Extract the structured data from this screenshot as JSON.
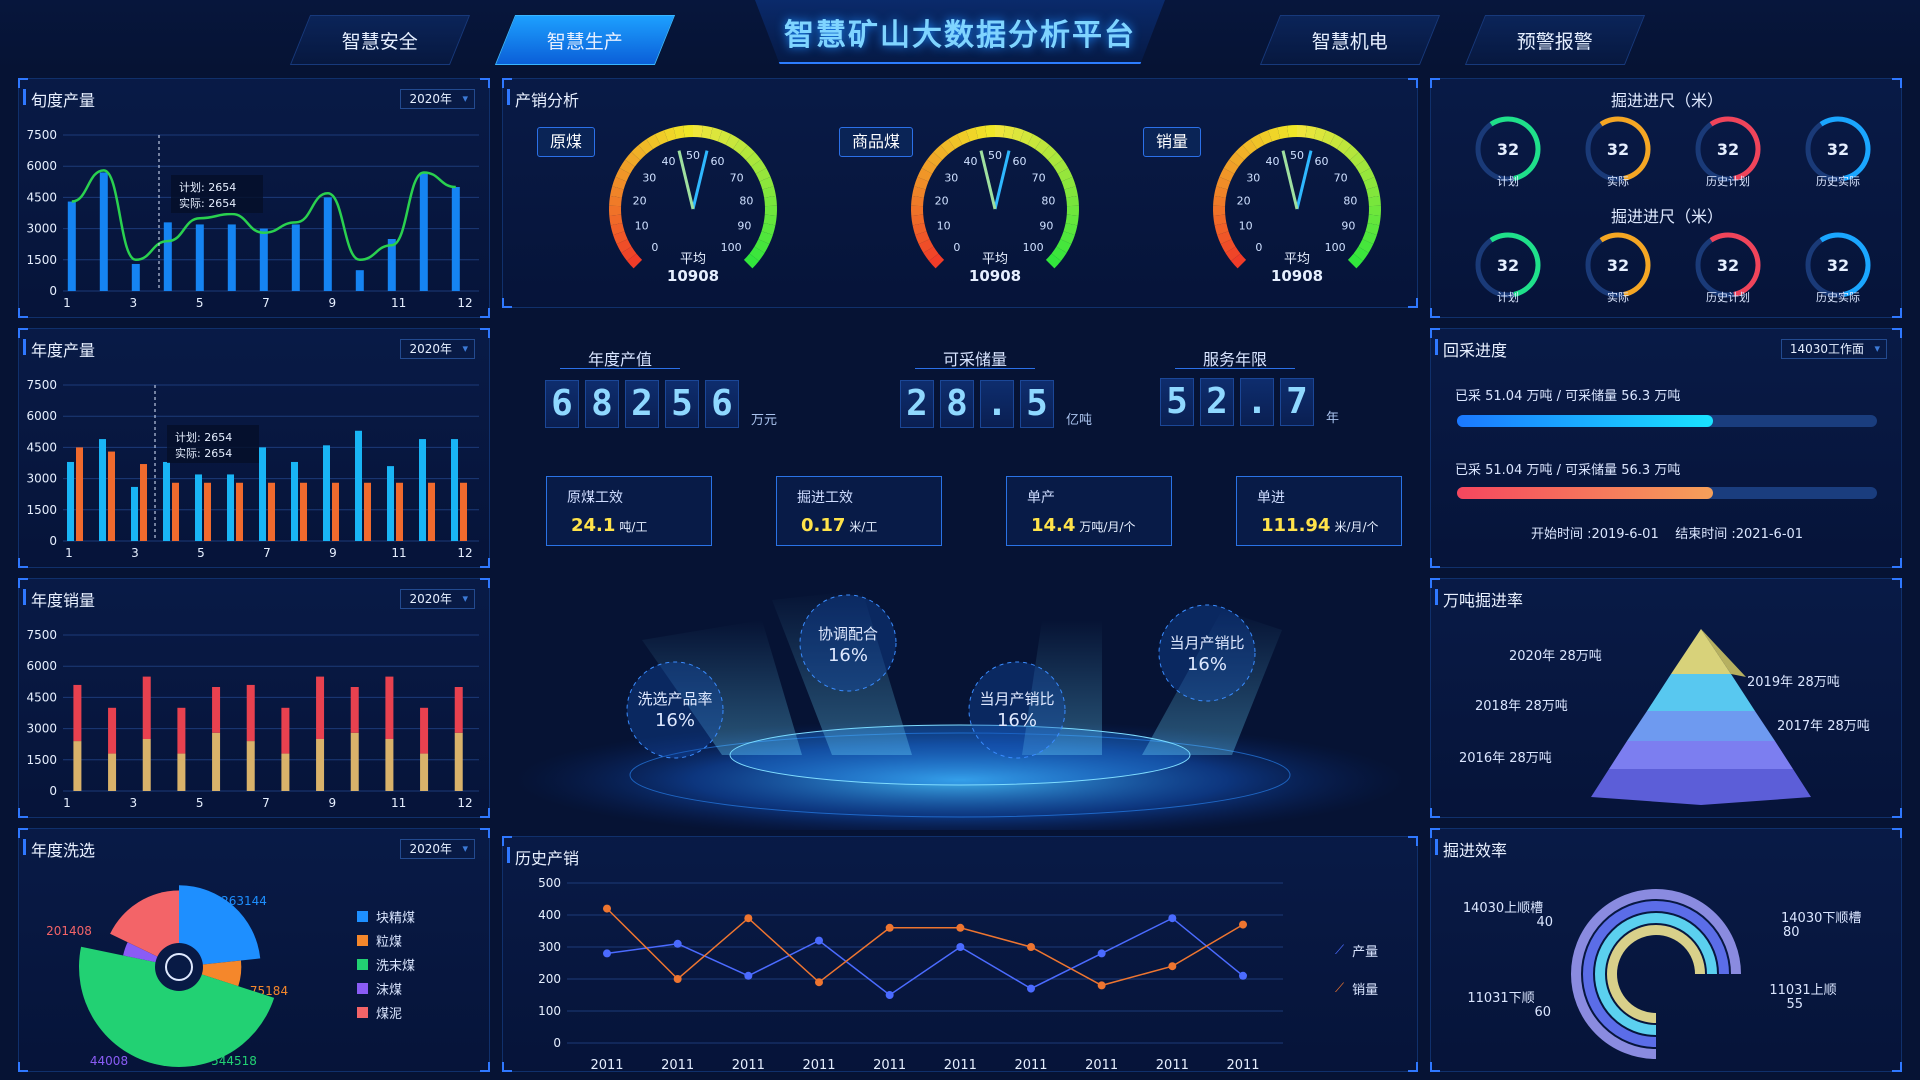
{
  "header": {
    "title": "智慧矿山大数据分析平台",
    "tabs": [
      {
        "label": "智慧安全",
        "active": false
      },
      {
        "label": "智慧生产",
        "active": true
      },
      {
        "label": "智慧机电",
        "active": false
      },
      {
        "label": "预警报警",
        "active": false
      }
    ]
  },
  "colors": {
    "accent": "#2f78ff",
    "bg": "#061334"
  },
  "panels": {
    "xun": {
      "title": "旬度产量",
      "select": "2020年"
    },
    "nian": {
      "title": "年度产量",
      "select": "2020年"
    },
    "xiao": {
      "title": "年度销量",
      "select": "2020年"
    },
    "xixuan": {
      "title": "年度洗选",
      "select": "2020年"
    },
    "chanxiao": {
      "title": "产销分析"
    },
    "lishi": {
      "title": "历史产销"
    },
    "huicai": {
      "title": "回采进度",
      "select": "14030工作面"
    },
    "wandun": {
      "title": "万吨掘进率"
    },
    "jjxl": {
      "title": "掘进效率"
    }
  },
  "tooltip": {
    "plan": "计划: 2654",
    "actual": "实际: 2654"
  },
  "gauges": [
    {
      "tag": "原煤",
      "avg_label": "平均",
      "avg_value": "10908",
      "value": 55
    },
    {
      "tag": "商品煤",
      "avg_label": "平均",
      "avg_value": "10908",
      "value": 55
    },
    {
      "tag": "销量",
      "avg_label": "平均",
      "avg_value": "10908",
      "value": 55
    }
  ],
  "gauge_ticks": [
    "0",
    "10",
    "20",
    "30",
    "40",
    "50",
    "60",
    "70",
    "80",
    "90",
    "100"
  ],
  "kpis": [
    {
      "label": "年度产值",
      "digits": [
        "6",
        "8",
        "2",
        "5",
        "6"
      ],
      "unit": "万元"
    },
    {
      "label": "可采储量",
      "digits": [
        "2",
        "8",
        ".",
        "5"
      ],
      "unit": "亿吨"
    },
    {
      "label": "服务年限",
      "digits": [
        "5",
        "2",
        ".",
        "7"
      ],
      "unit": "年"
    }
  ],
  "kboxes": [
    {
      "label": "原煤工效",
      "value": "24.1",
      "unit": "吨/工"
    },
    {
      "label": "掘进工效",
      "value": "0.17",
      "unit": "米/工"
    },
    {
      "label": "单产",
      "value": "14.4",
      "unit": "万吨/月/个"
    },
    {
      "label": "单进",
      "value": "111.94",
      "unit": "米/月/个"
    }
  ],
  "bubbles": [
    {
      "label": "洗选产品率",
      "value": "16%"
    },
    {
      "label": "协调配合",
      "value": "16%"
    },
    {
      "label": "当月产销比",
      "value": "16%"
    },
    {
      "label": "当月产销比",
      "value": "16%"
    }
  ],
  "jueji": {
    "title1": "掘进进尺（米）",
    "title2": "掘进进尺（米）",
    "row1": [
      {
        "value": "32",
        "label": "计划",
        "color": "#1fe08a"
      },
      {
        "value": "32",
        "label": "实际",
        "color": "#f5a623"
      },
      {
        "value": "32",
        "label": "历史计划",
        "color": "#f0445a"
      },
      {
        "value": "32",
        "label": "历史实际",
        "color": "#1aa6ff"
      }
    ],
    "row2": [
      {
        "value": "32",
        "label": "计划",
        "color": "#1fe08a"
      },
      {
        "value": "32",
        "label": "实际",
        "color": "#f5a623"
      },
      {
        "value": "32",
        "label": "历史计划",
        "color": "#f0445a"
      },
      {
        "value": "32",
        "label": "历史实际",
        "color": "#1aa6ff"
      }
    ]
  },
  "huicai": {
    "line1": "已采 51.04 万吨 / 可采储量 56.3 万吨",
    "line2": "已采 51.04 万吨 / 可采储量 56.3 万吨",
    "progress1": 0.61,
    "progress2": 0.61,
    "dates": "开始时间 :2019-6-01    结束时间 :2021-6-01"
  },
  "pyramid": {
    "labels": [
      "2020年 28万吨",
      "2019年 28万吨",
      "2018年 28万吨",
      "2017年 28万吨",
      "2016年 28万吨"
    ]
  },
  "jjxl": {
    "items": [
      {
        "name": "14030上顺槽",
        "value": "40"
      },
      {
        "name": "14030下顺槽",
        "value": "80"
      },
      {
        "name": "11031下顺",
        "value": "60"
      },
      {
        "name": "11031上顺",
        "value": "55"
      }
    ]
  },
  "chart_data": [
    {
      "type": "bar",
      "title": "旬度产量",
      "categories": [
        "1",
        "2",
        "3",
        "4",
        "5",
        "6",
        "7",
        "8",
        "9",
        "10",
        "11",
        "12"
      ],
      "x_tick_labels": [
        "1",
        "3",
        "5",
        "7",
        "9",
        "11",
        "12"
      ],
      "ylim": [
        0,
        7500
      ],
      "yticks": [
        0,
        1500,
        3000,
        4500,
        6000,
        7500
      ],
      "series": [
        {
          "type": "bar",
          "values": [
            4300,
            5700,
            1300,
            3300,
            3200,
            3200,
            3000,
            3200,
            4500,
            1000,
            2500,
            5700,
            5000
          ]
        },
        {
          "type": "line",
          "values": [
            4300,
            5800,
            1500,
            2400,
            3500,
            3700,
            2800,
            3300,
            4700,
            1500,
            2200,
            5700,
            5000
          ]
        }
      ]
    },
    {
      "type": "bar",
      "title": "年度产量",
      "categories": [
        "1",
        "2",
        "3",
        "4",
        "5",
        "6",
        "7",
        "8",
        "9",
        "10",
        "11",
        "12"
      ],
      "x_tick_labels": [
        "1",
        "3",
        "5",
        "7",
        "9",
        "11",
        "12"
      ],
      "ylim": [
        0,
        7500
      ],
      "yticks": [
        0,
        1500,
        3000,
        4500,
        6000,
        7500
      ],
      "series": [
        {
          "color": "#19b5f5",
          "values": [
            3800,
            4900,
            2600,
            3800,
            3200,
            3200,
            4500,
            3800,
            4600,
            5300,
            3600,
            4900,
            4900
          ]
        },
        {
          "color": "#f06a2d",
          "values": [
            4500,
            4300,
            3700,
            2800,
            2800,
            2800,
            2800,
            2800,
            2800,
            2800,
            2800,
            2800,
            2800
          ]
        }
      ]
    },
    {
      "type": "bar",
      "title": "年度销量",
      "categories": [
        "1",
        "2",
        "3",
        "4",
        "5",
        "6",
        "7",
        "8",
        "9",
        "10",
        "11",
        "12"
      ],
      "x_tick_labels": [
        "1",
        "3",
        "5",
        "7",
        "9",
        "11",
        "12"
      ],
      "ylim": [
        0,
        7500
      ],
      "yticks": [
        0,
        1500,
        3000,
        4500,
        6000,
        7500
      ],
      "stacked": true,
      "series": [
        {
          "color": "#d9b26a",
          "values": [
            2400,
            1800,
            2500,
            1800,
            2800,
            2400,
            1800,
            2500,
            2800,
            2500,
            1800,
            2800
          ]
        },
        {
          "color": "#e8414f",
          "values": [
            2700,
            2200,
            3000,
            2200,
            2200,
            2700,
            2200,
            3000,
            2200,
            3000,
            2200,
            2200
          ]
        }
      ]
    },
    {
      "type": "pie",
      "title": "年度洗选",
      "slices": [
        {
          "name": "块精煤",
          "value": 263144,
          "color": "#1e8fff"
        },
        {
          "name": "粒煤",
          "value": 75184,
          "color": "#f5872b"
        },
        {
          "name": "洗末煤",
          "value": 544518,
          "color": "#22d173"
        },
        {
          "name": "沫煤",
          "value": 44008,
          "color": "#8a5cf5"
        },
        {
          "name": "煤泥",
          "value": 201408,
          "color": "#f36468"
        }
      ]
    },
    {
      "type": "line",
      "title": "历史产销",
      "x": [
        "2011",
        "2011",
        "2011",
        "2011",
        "2011",
        "2011",
        "2011",
        "2011",
        "2011",
        "2011"
      ],
      "ylim": [
        0,
        500
      ],
      "yticks": [
        0,
        100,
        200,
        300,
        400,
        500
      ],
      "series": [
        {
          "name": "产量",
          "color": "#4b6bff",
          "values": [
            280,
            310,
            210,
            320,
            150,
            300,
            170,
            280,
            390,
            210
          ]
        },
        {
          "name": "销量",
          "color": "#ee7530",
          "values": [
            420,
            200,
            390,
            190,
            360,
            360,
            300,
            180,
            240,
            370
          ]
        }
      ]
    }
  ]
}
